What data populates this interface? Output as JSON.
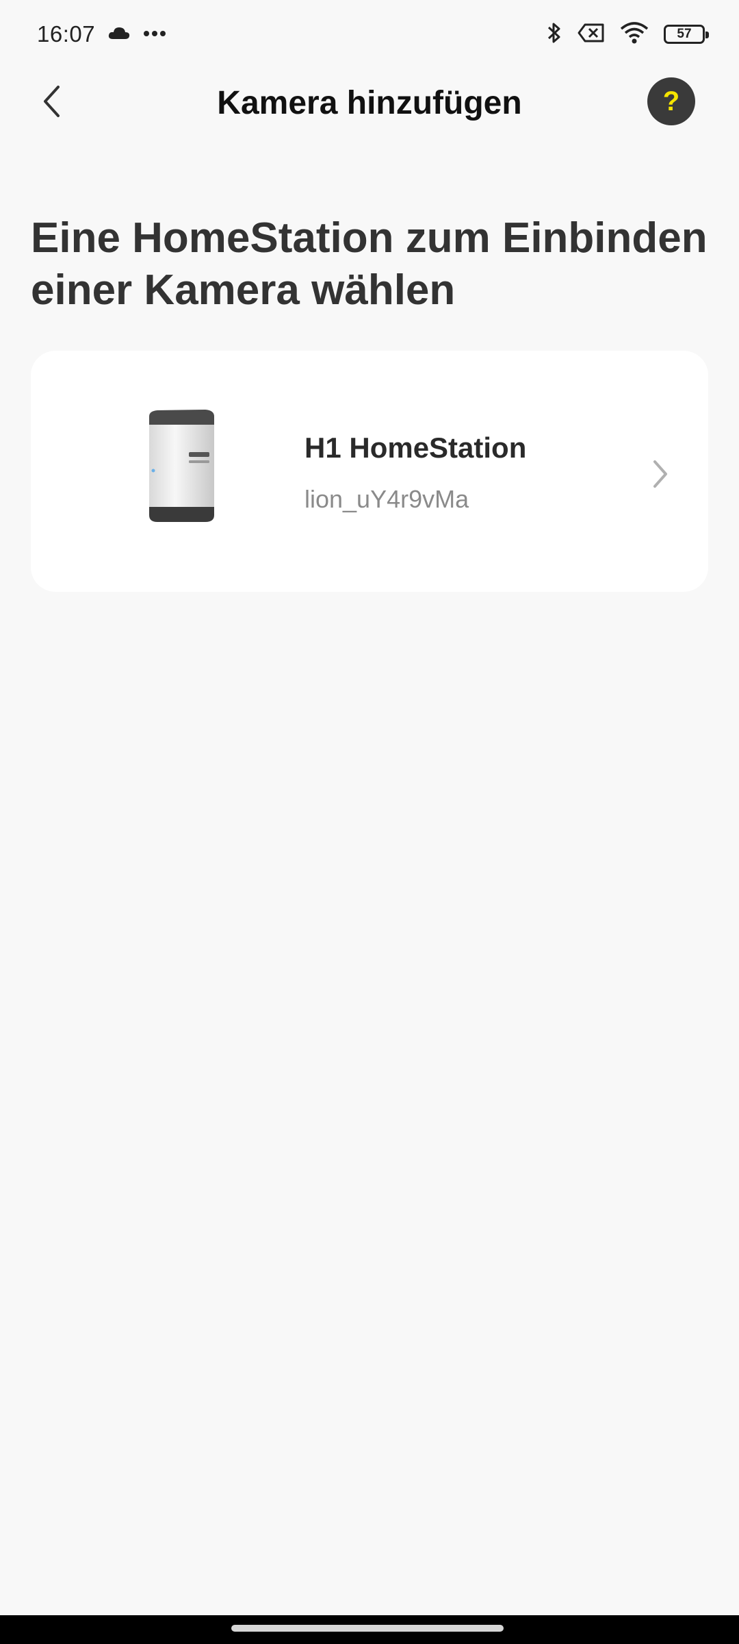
{
  "status_bar": {
    "time": "16:07",
    "battery_level": "57",
    "icons": [
      "cloud-icon",
      "more-dots-icon",
      "bluetooth-icon",
      "no-sim-icon",
      "wifi-icon",
      "battery-icon"
    ]
  },
  "header": {
    "title": "Kamera hinzufügen",
    "help_label": "?"
  },
  "main": {
    "heading": "Eine HomeStation zum Einbinden einer Kamera wählen",
    "devices": [
      {
        "name": "H1 HomeStation",
        "id": "lion_uY4r9vMa",
        "image": "homestation-device-image"
      }
    ]
  },
  "colors": {
    "background": "#f8f8f8",
    "card": "#ffffff",
    "help_bg": "#3a3a3a",
    "help_fg": "#f5e400"
  }
}
